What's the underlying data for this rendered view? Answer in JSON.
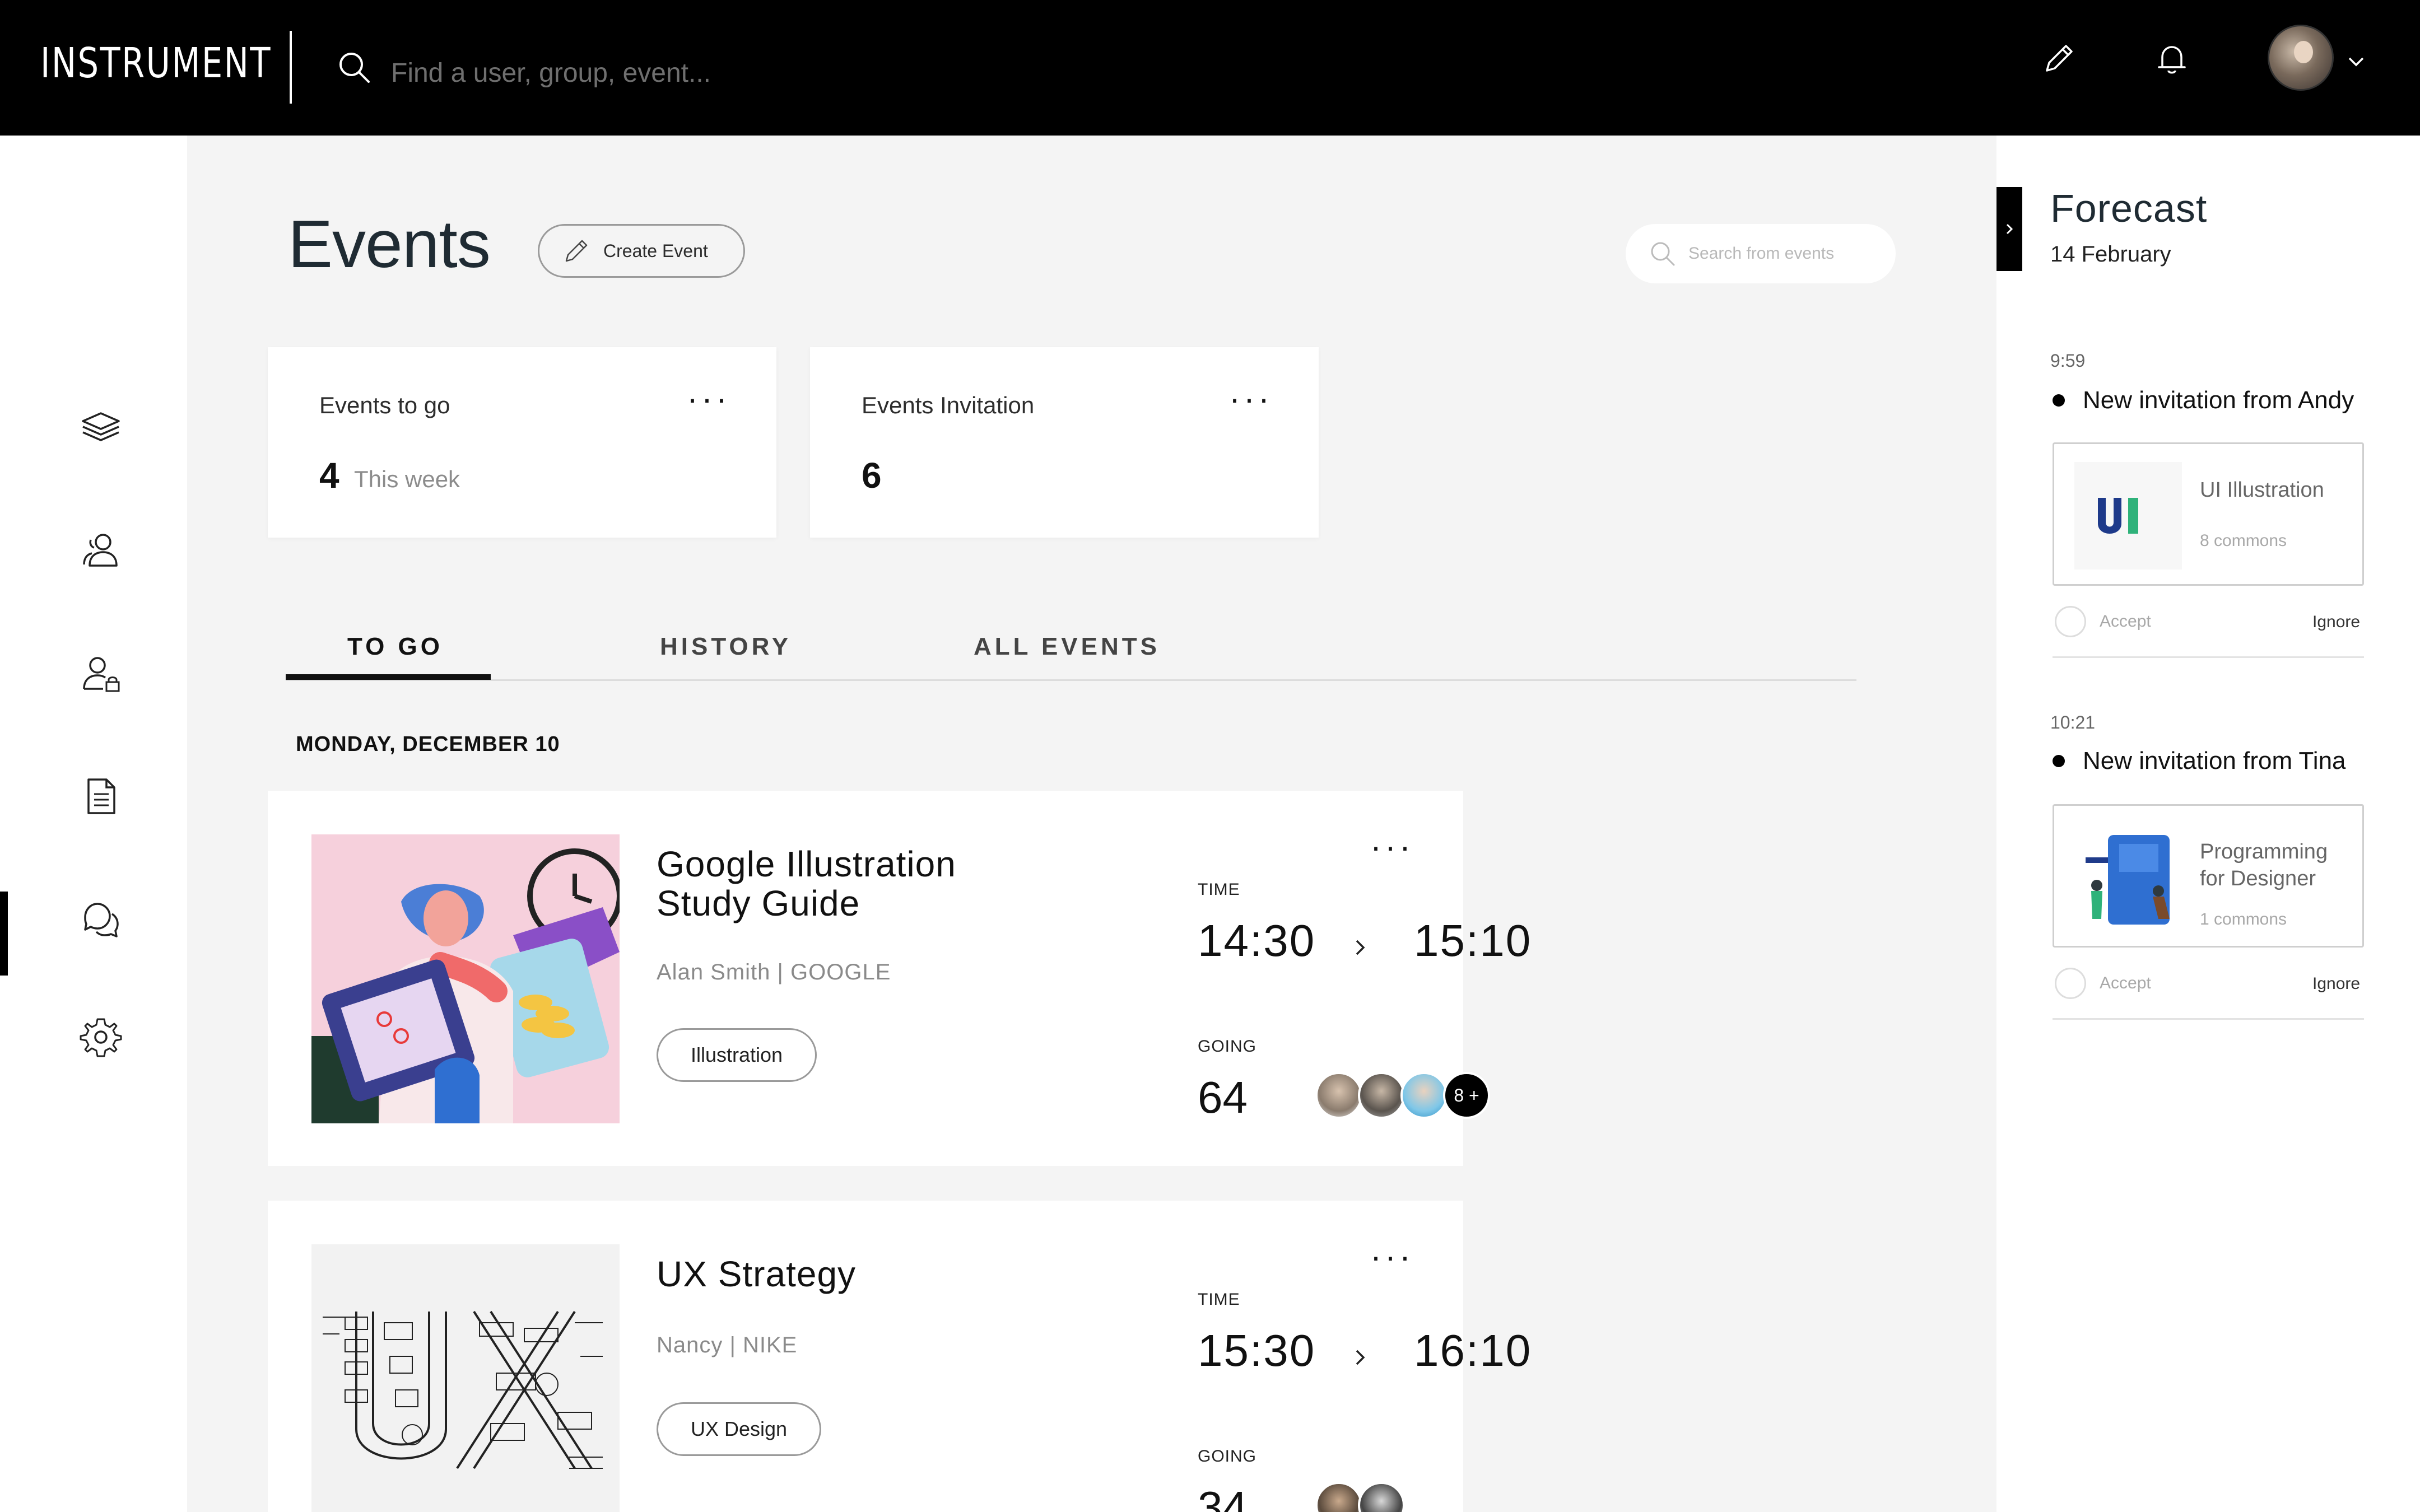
{
  "app": {
    "logo": "INSTRUMENT"
  },
  "topbar": {
    "search_placeholder": "Find a user, group, event..."
  },
  "page": {
    "title": "Events",
    "create_label": "Create Event",
    "search_placeholder": "Search from events"
  },
  "stats": [
    {
      "label": "Events to go",
      "value": "4",
      "sub": "This week"
    },
    {
      "label": "Events Invitation",
      "value": "6",
      "sub": ""
    }
  ],
  "tabs": [
    {
      "label": "TO GO",
      "active": true
    },
    {
      "label": "HISTORY",
      "active": false
    },
    {
      "label": "ALL EVENTS",
      "active": false
    }
  ],
  "day_header": "MONDAY, DECEMBER 10",
  "events": [
    {
      "title": "Google Illustration Study Guide",
      "author": "Alan Smith | GOOGLE",
      "tag": "Illustration",
      "time_label": "TIME",
      "start": "14:30",
      "end": "15:10",
      "going_label": "GOING",
      "going": "64",
      "more": "8 +"
    },
    {
      "title": "UX Strategy",
      "author": "Nancy | NIKE",
      "tag": "UX Design",
      "time_label": "TIME",
      "start": "15:30",
      "end": "16:10",
      "going_label": "GOING",
      "going": "34"
    }
  ],
  "forecast": {
    "title": "Forecast",
    "date": "14 February",
    "items": [
      {
        "time": "9:59",
        "message": "New invitation from Andy",
        "card_title": "UI Illustration",
        "card_sub": "8 commons",
        "accept": "Accept",
        "ignore": "Ignore"
      },
      {
        "time": "10:21",
        "message": "New invitation from Tina",
        "card_title": "Programming for Designer",
        "card_sub": "1 commons",
        "accept": "Accept",
        "ignore": "Ignore"
      }
    ]
  },
  "colors": {
    "topbar": "#000000",
    "accent_blue": "#1e3a8a",
    "accent_green": "#2fb27a"
  }
}
